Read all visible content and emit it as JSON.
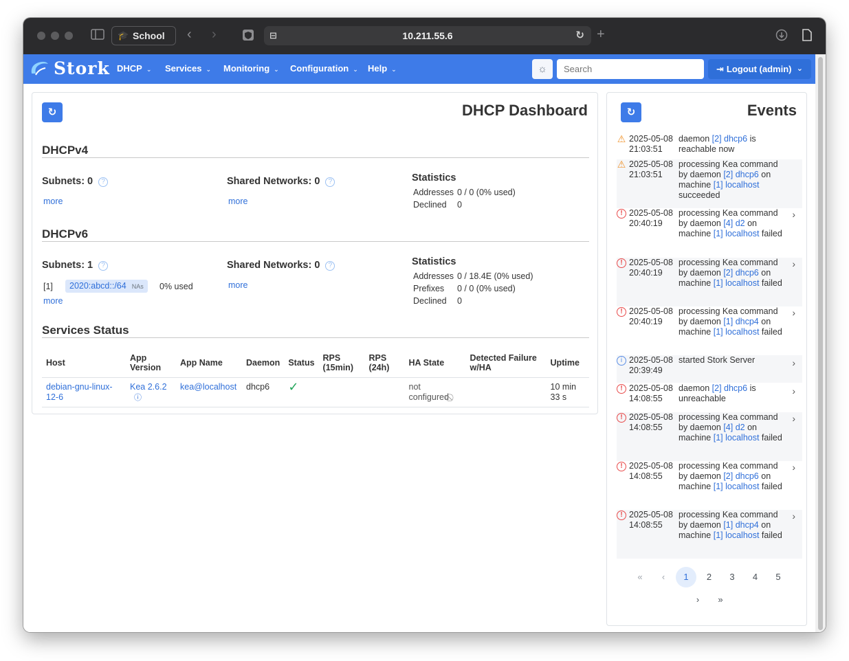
{
  "browser": {
    "profile": "School",
    "address": "10.211.55.6"
  },
  "navbar": {
    "brand": "Stork",
    "menu": [
      "DHCP",
      "Services",
      "Monitoring",
      "Configuration",
      "Help"
    ],
    "search_placeholder": "Search",
    "logout": "Logout (admin)"
  },
  "dashboard": {
    "title": "DHCP Dashboard",
    "v4": {
      "heading": "DHCPv4",
      "subnets": "Subnets: 0",
      "shared": "Shared Networks: 0",
      "more1": "more",
      "more2": "more",
      "stats_title": "Statistics",
      "stats": [
        {
          "label": "Addresses",
          "value": "0 / 0 (0% used)"
        },
        {
          "label": "Declined",
          "value": "0"
        }
      ]
    },
    "v6": {
      "heading": "DHCPv6",
      "subnets": "Subnets: 1",
      "shared": "Shared Networks: 0",
      "subnet_index": "[1]",
      "subnet_prefix": "2020:abcd::/64",
      "subnet_tag": "NAs",
      "subnet_usage": "0% used",
      "more1": "more",
      "more2": "more",
      "stats_title": "Statistics",
      "stats": [
        {
          "label": "Addresses",
          "value": "0 / 18.4E (0% used)"
        },
        {
          "label": "Prefixes",
          "value": "0 / 0 (0% used)"
        },
        {
          "label": "Declined",
          "value": "0"
        }
      ]
    },
    "services": {
      "heading": "Services Status",
      "columns": [
        "Host",
        "App Version",
        "App Name",
        "Daemon",
        "Status",
        "RPS (15min)",
        "RPS (24h)",
        "HA State",
        "Detected Failure w/HA",
        "Uptime"
      ],
      "row": {
        "host": "debian-gnu-linux-12-6",
        "app_version": "Kea 2.6.2",
        "app_name": "kea@localhost",
        "daemon": "dhcp6",
        "status": "✓",
        "rps15": "",
        "rps24": "",
        "ha_state": "not configured",
        "failure": "",
        "uptime": "10 min 33 s"
      }
    }
  },
  "events": {
    "title": "Events",
    "items": [
      {
        "level": "warn",
        "date": "2025-05-08",
        "time": "21:03:51",
        "parts": [
          [
            "t",
            "daemon "
          ],
          [
            "l",
            "[2] dhcp6"
          ],
          [
            "t",
            " is reachable now"
          ]
        ]
      },
      {
        "level": "warn",
        "date": "2025-05-08",
        "time": "21:03:51",
        "parts": [
          [
            "t",
            "processing Kea command by daemon "
          ],
          [
            "l",
            "[2] dhcp6"
          ],
          [
            "t",
            " on machine "
          ],
          [
            "l",
            "[1] localhost"
          ],
          [
            "t",
            " succeeded"
          ]
        ]
      },
      {
        "level": "err",
        "date": "2025-05-08",
        "time": "20:40:19",
        "parts": [
          [
            "t",
            "processing Kea command by daemon "
          ],
          [
            "l",
            "[4] d2"
          ],
          [
            "t",
            " on machine "
          ],
          [
            "l",
            "[1] localhost"
          ],
          [
            "t",
            " failed"
          ]
        ]
      },
      {
        "level": "err",
        "date": "2025-05-08",
        "time": "20:40:19",
        "parts": [
          [
            "t",
            "processing Kea command by daemon "
          ],
          [
            "l",
            "[2] dhcp6"
          ],
          [
            "t",
            " on machine "
          ],
          [
            "l",
            "[1] localhost"
          ],
          [
            "t",
            " failed"
          ]
        ]
      },
      {
        "level": "err",
        "date": "2025-05-08",
        "time": "20:40:19",
        "parts": [
          [
            "t",
            "processing Kea command by daemon "
          ],
          [
            "l",
            "[1] dhcp4"
          ],
          [
            "t",
            " on machine "
          ],
          [
            "l",
            "[1] localhost"
          ],
          [
            "t",
            " failed"
          ]
        ]
      },
      {
        "level": "info",
        "date": "2025-05-08",
        "time": "20:39:49",
        "parts": [
          [
            "t",
            "started Stork Server"
          ]
        ]
      },
      {
        "level": "err",
        "date": "2025-05-08",
        "time": "14:08:55",
        "parts": [
          [
            "t",
            "daemon "
          ],
          [
            "l",
            "[2] dhcp6"
          ],
          [
            "t",
            " is unreachable"
          ]
        ]
      },
      {
        "level": "err",
        "date": "2025-05-08",
        "time": "14:08:55",
        "parts": [
          [
            "t",
            "processing Kea command by daemon "
          ],
          [
            "l",
            "[4] d2"
          ],
          [
            "t",
            " on machine "
          ],
          [
            "l",
            "[1] localhost"
          ],
          [
            "t",
            " failed"
          ]
        ]
      },
      {
        "level": "err",
        "date": "2025-05-08",
        "time": "14:08:55",
        "parts": [
          [
            "t",
            "processing Kea command by daemon "
          ],
          [
            "l",
            "[2] dhcp6"
          ],
          [
            "t",
            " on machine "
          ],
          [
            "l",
            "[1] localhost"
          ],
          [
            "t",
            " failed"
          ]
        ]
      },
      {
        "level": "err",
        "date": "2025-05-08",
        "time": "14:08:55",
        "parts": [
          [
            "t",
            "processing Kea command by daemon "
          ],
          [
            "l",
            "[1] dhcp4"
          ],
          [
            "t",
            " on machine "
          ],
          [
            "l",
            "[1] localhost"
          ],
          [
            "t",
            " failed"
          ]
        ]
      }
    ],
    "pagination": {
      "pages": [
        "1",
        "2",
        "3",
        "4",
        "5"
      ],
      "current": "1"
    }
  }
}
